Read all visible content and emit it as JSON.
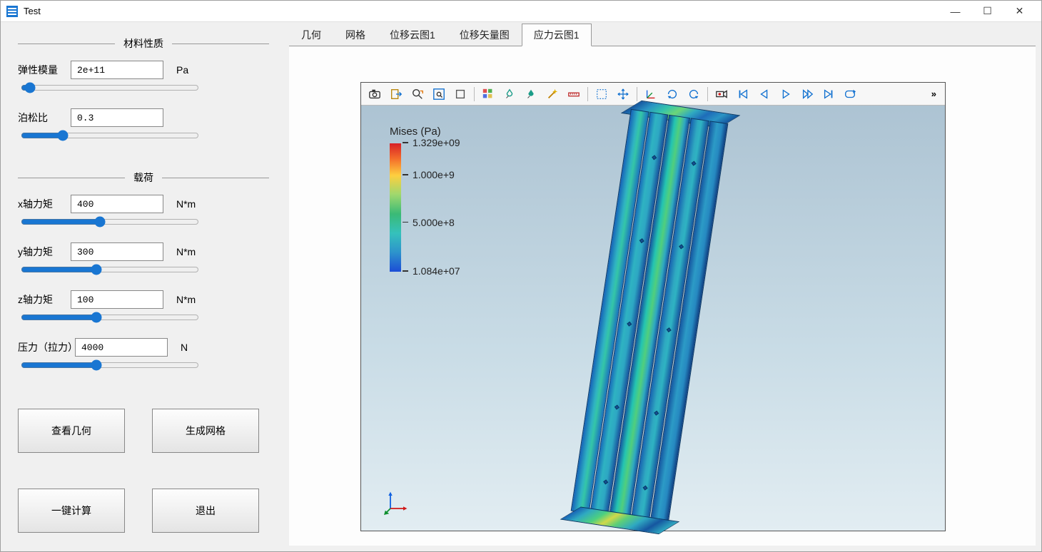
{
  "title": "Test",
  "window_controls": {
    "min": "—",
    "max": "☐",
    "close": "✕"
  },
  "groups": {
    "material": "材料性质",
    "load": "载荷"
  },
  "fields": {
    "elastic": {
      "label": "弹性模量",
      "value": "2e+11",
      "unit": "Pa"
    },
    "poisson": {
      "label": "泊松比",
      "value": "0.3",
      "unit": ""
    },
    "mx": {
      "label": "x轴力矩",
      "value": "400",
      "unit": "N*m"
    },
    "my": {
      "label": "y轴力矩",
      "value": "300",
      "unit": "N*m"
    },
    "mz": {
      "label": "z轴力矩",
      "value": "100",
      "unit": "N*m"
    },
    "force": {
      "label": "压力（拉力）",
      "value": "4000",
      "unit": "N"
    }
  },
  "buttons": {
    "view_geom": "查看几何",
    "gen_mesh": "生成网格",
    "compute": "一键计算",
    "exit": "退出"
  },
  "tabs": [
    {
      "key": "geom",
      "label": "几何",
      "active": false
    },
    {
      "key": "mesh",
      "label": "网格",
      "active": false
    },
    {
      "key": "disp1",
      "label": "位移云图1",
      "active": false
    },
    {
      "key": "dispv",
      "label": "位移矢量图",
      "active": false
    },
    {
      "key": "stress1",
      "label": "应力云图1",
      "active": true
    }
  ],
  "legend": {
    "title": "Mises (Pa)",
    "ticks": [
      {
        "label": "1.329e+09",
        "pos": 0
      },
      {
        "label": "1.000e+9",
        "pos": 25
      },
      {
        "label": "5.000e+8",
        "pos": 62
      },
      {
        "label": "1.084e+07",
        "pos": 100
      }
    ]
  },
  "toolbar_icons": [
    "camera-icon",
    "export-icon",
    "zoom-area-icon",
    "zoom-fit-icon",
    "box-icon",
    "palette-icon",
    "drop1-icon",
    "drop2-icon",
    "magic-icon",
    "ruler-icon",
    "select-box-icon",
    "move-icon",
    "axis-icon",
    "rotate-cw-icon",
    "rotate-ccw-icon",
    "record-icon",
    "skip-first-icon",
    "step-back-icon",
    "play-icon",
    "step-fwd-icon",
    "skip-last-icon",
    "loop-icon"
  ],
  "overflow": "»"
}
